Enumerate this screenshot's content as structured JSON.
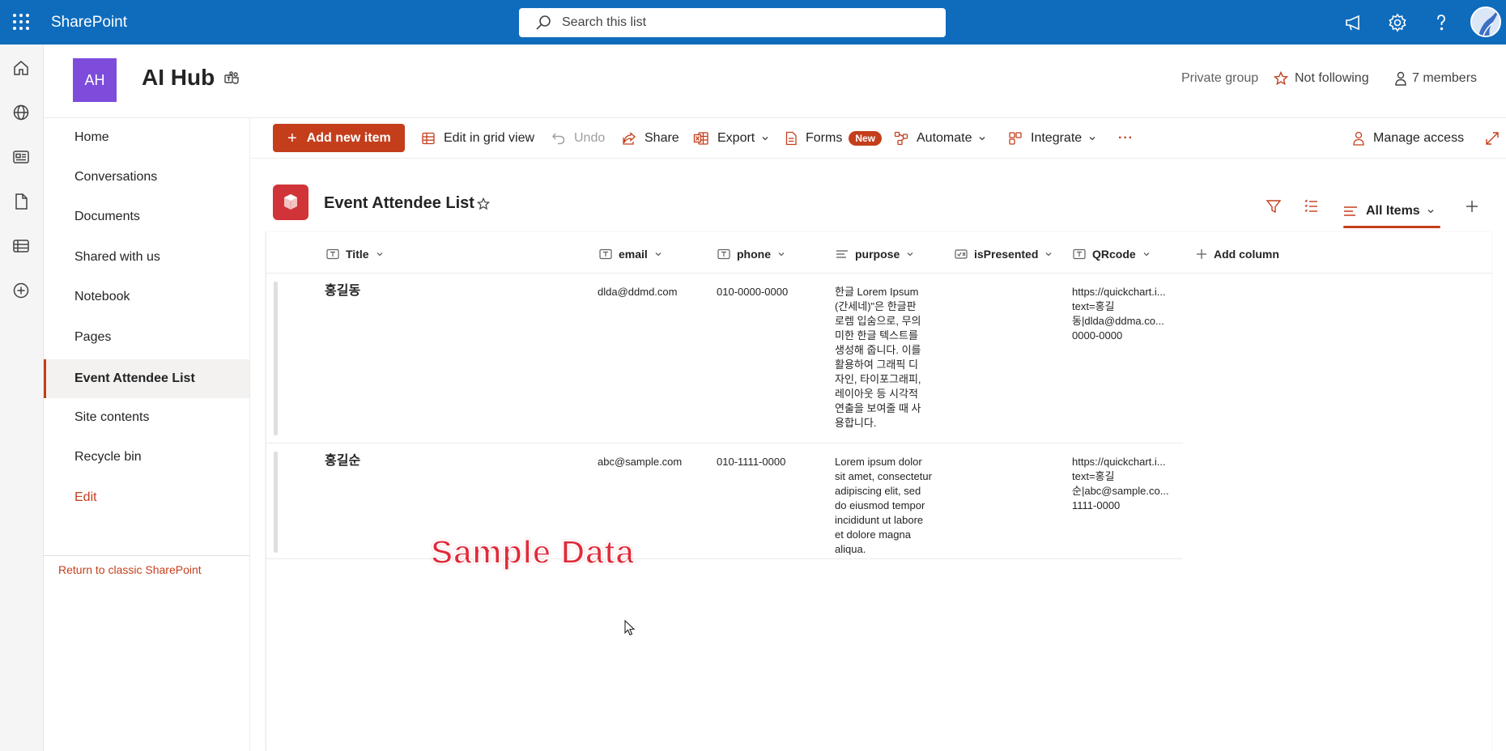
{
  "suite": {
    "brand": "SharePoint",
    "search_placeholder": "Search this list",
    "icons": [
      "app-launcher-icon",
      "megaphone-icon",
      "gear-icon",
      "help-icon",
      "avatar"
    ],
    "accent": "#0f6cbd"
  },
  "site": {
    "logo_text": "AH",
    "logo_color": "#7d4cdb",
    "title": "AI Hub",
    "group_type": "Private group",
    "follow": "Not following",
    "members": "7 members"
  },
  "nav": {
    "items": [
      {
        "label": "Home"
      },
      {
        "label": "Conversations"
      },
      {
        "label": "Documents"
      },
      {
        "label": "Shared with us"
      },
      {
        "label": "Notebook"
      },
      {
        "label": "Pages"
      },
      {
        "label": "Event Attendee List",
        "active": true
      },
      {
        "label": "Site contents"
      },
      {
        "label": "Recycle bin"
      },
      {
        "label": "Edit"
      }
    ],
    "classic_link": "Return to classic SharePoint"
  },
  "commands": {
    "add_new": "Add new item",
    "grid_view": "Edit in grid view",
    "undo": "Undo",
    "share": "Share",
    "export": "Export",
    "forms": "Forms",
    "forms_badge": "New",
    "automate": "Automate",
    "integrate": "Integrate",
    "more": "···",
    "manage_access": "Manage access"
  },
  "list": {
    "title": "Event Attendee List",
    "view": "All Items",
    "columns": [
      "Title",
      "email",
      "phone",
      "purpose",
      "isPresented",
      "QRcode",
      "Add column"
    ],
    "rows": [
      {
        "title": "홍길동",
        "email": "dlda@ddmd.com",
        "phone": "010-0000-0000",
        "purpose": [
          "한글 Lorem Ipsum",
          "(간세네)\"은 한글판",
          "로렘 입숨으로, 무의",
          "미한 한글 텍스트를",
          "생성해 줍니다. 이를",
          "활용하여 그래픽 디",
          "자인, 타이포그래피,",
          "레이아웃 등 시각적",
          "연출을 보여줄 때 사",
          "용합니다."
        ],
        "isPresented": "",
        "qrcode": [
          "https://quickchart.i...",
          "text=홍길",
          "동|dlda@ddma.co...",
          "0000-0000"
        ]
      },
      {
        "title": "홍길순",
        "email": "abc@sample.com",
        "phone": "010-1111-0000",
        "purpose": [
          "Lorem ipsum dolor",
          "sit amet, consectetur",
          "adipiscing elit, sed",
          "do eiusmod tempor",
          "incididunt ut labore",
          "et dolore magna",
          "aliqua."
        ],
        "isPresented": "",
        "qrcode": [
          "https://quickchart.i...",
          "text=홍길",
          "순|abc@sample.co...",
          "1111-0000"
        ]
      }
    ],
    "watermark": "Sample Data"
  }
}
